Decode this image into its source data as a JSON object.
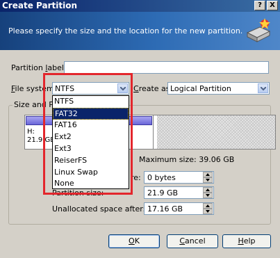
{
  "window": {
    "title": "Create Partition",
    "help_btn": "?",
    "close_btn": "X"
  },
  "banner": {
    "text": "Please specify the size and the location for the new partition."
  },
  "form": {
    "partition_label": {
      "label_pre": "Partition ",
      "label_u": "l",
      "label_post": "abel:",
      "value": ""
    },
    "file_system": {
      "label_pre": "",
      "label_u": "F",
      "label_post": "ile system:",
      "value": "NTFS"
    },
    "create_as": {
      "label_pre": "",
      "label_u": "C",
      "label_post": "reate as:",
      "value": "Logical Partition"
    }
  },
  "size_group": {
    "caption": "Size and Po",
    "map_label_line1": "H:",
    "map_label_line2": "21.9 GB",
    "max_size": "Maximum size: 39.06 GB",
    "space_before_label": "re:",
    "space_before_value": "0 bytes",
    "partition_size_label": "Partition size:",
    "partition_size_value": "21.9 GB",
    "unallocated_after_label": "Unallocated space after:",
    "unallocated_after_value": "17.16 GB"
  },
  "dropdown": {
    "items": [
      "NTFS",
      "FAT32",
      "FAT16",
      "Ext2",
      "Ext3",
      "ReiserFS",
      "Linux Swap",
      "None"
    ],
    "selected_index": 1
  },
  "buttons": {
    "ok": {
      "u": "O",
      "rest": "K"
    },
    "cancel": {
      "u": "C",
      "rest": "ancel"
    },
    "help": {
      "u": "H",
      "rest": "elp"
    }
  },
  "colors": {
    "highlight": "#e3262c",
    "selection": "#0a246a"
  }
}
